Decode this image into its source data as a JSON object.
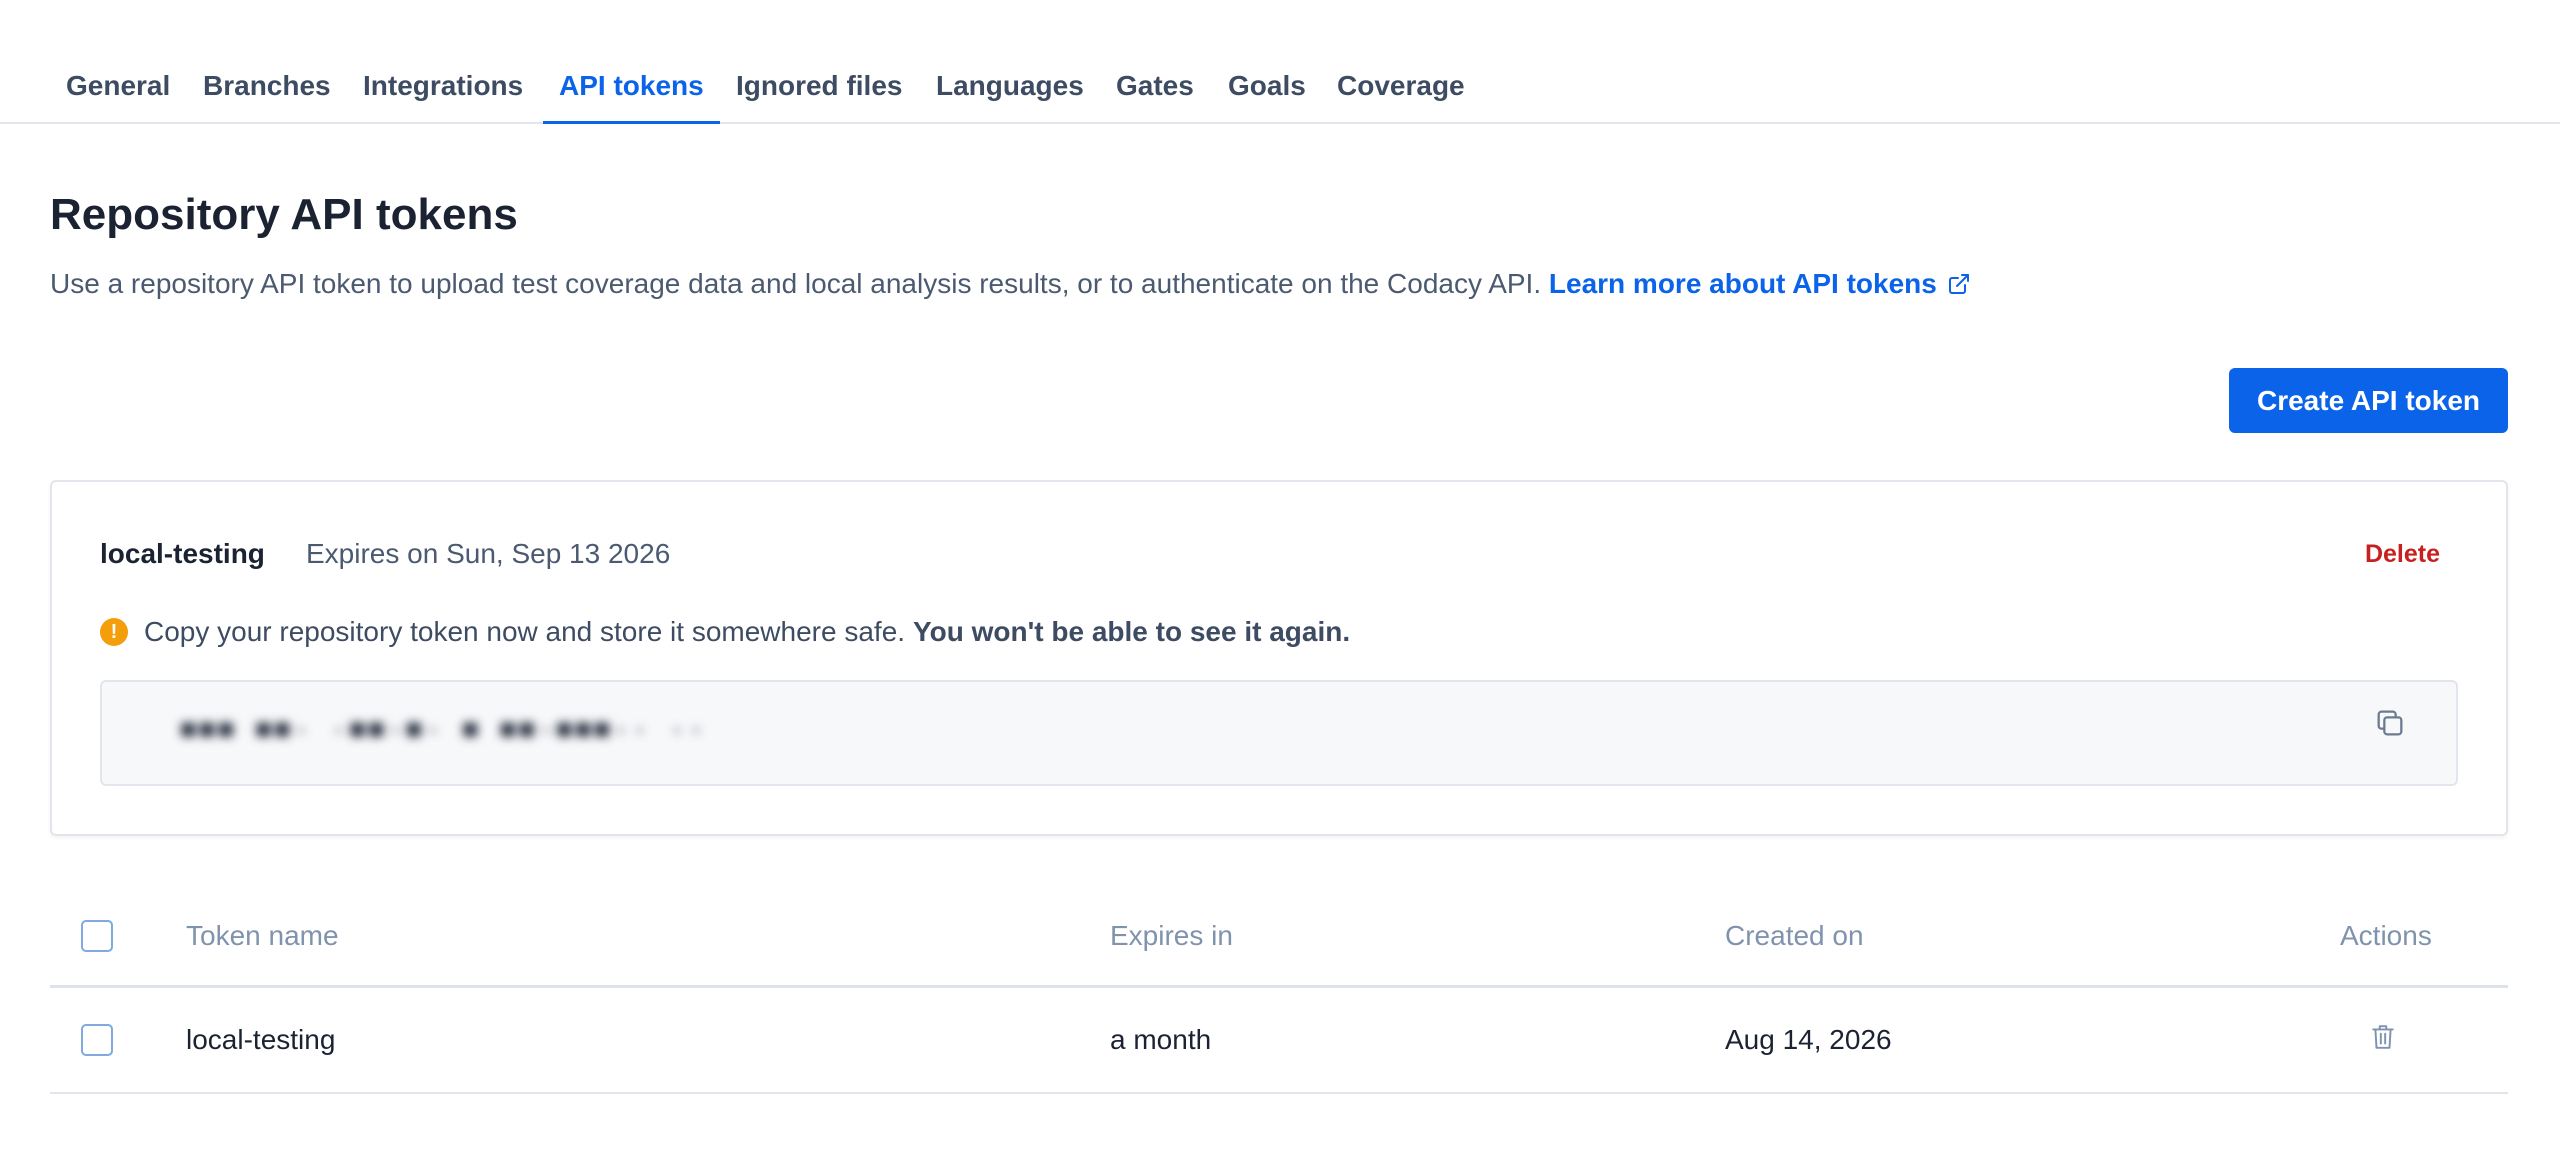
{
  "tabs": [
    {
      "label": "General"
    },
    {
      "label": "Branches"
    },
    {
      "label": "Integrations"
    },
    {
      "label": "API tokens",
      "active": true
    },
    {
      "label": "Ignored files"
    },
    {
      "label": "Languages"
    },
    {
      "label": "Gates"
    },
    {
      "label": "Goals"
    },
    {
      "label": "Coverage"
    }
  ],
  "page": {
    "title": "Repository API tokens",
    "description": "Use a repository API token to upload test coverage data and local analysis results, or to authenticate on the Codacy API.",
    "learn_more": "Learn more about API tokens"
  },
  "create_button": "Create API token",
  "new_token": {
    "name": "local-testing",
    "expiry": "Expires on Sun, Sep 13 2026",
    "delete_label": "Delete",
    "warning_icon": "!",
    "warning": "Copy your repository token now and store it somewhere safe.",
    "warning_strong": "You won't be able to see it again.",
    "value": "■■■ ■■·   ·■■·■·  ■     ■■·■■■·· ··"
  },
  "table": {
    "columns": [
      "Token name",
      "Expires in",
      "Created on",
      "Actions"
    ],
    "rows": [
      {
        "name": "local-testing",
        "expires_in": "a month",
        "created_on": "Aug 14, 2026"
      }
    ]
  },
  "colors": {
    "accent": "#0a63e8",
    "danger": "#c81f1f",
    "warning": "#f59e0b"
  }
}
